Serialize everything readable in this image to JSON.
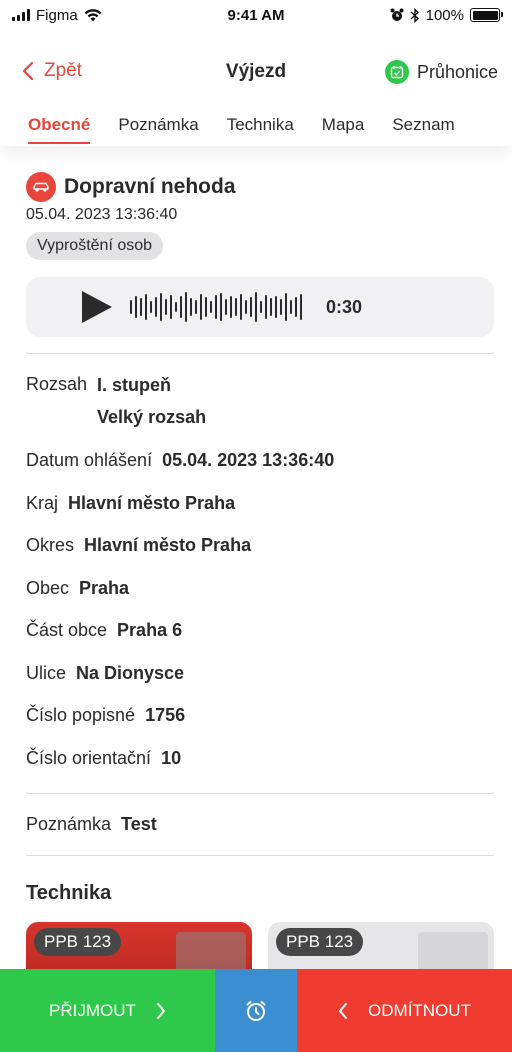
{
  "status_bar": {
    "carrier": "Figma",
    "time": "9:41 AM",
    "battery_percent": "100%",
    "battery_level": 1.0
  },
  "nav": {
    "back_label": "Zpět",
    "title": "Výjezd",
    "station": "Průhonice"
  },
  "tabs": [
    {
      "label": "Obecné",
      "active": true
    },
    {
      "label": "Poznámka",
      "active": false
    },
    {
      "label": "Technika",
      "active": false
    },
    {
      "label": "Mapa",
      "active": false
    },
    {
      "label": "Seznam",
      "active": false
    }
  ],
  "incident": {
    "title": "Dopravní nehoda",
    "datetime": "05.04. 2023 13:36:40",
    "tag": "Vyproštění osob",
    "icon": "car-icon"
  },
  "audio": {
    "duration": "0:30"
  },
  "details": {
    "rozsah": {
      "label": "Rozsah",
      "value1": "I. stupeň",
      "value2": "Velký rozsah"
    },
    "datum": {
      "label": "Datum ohlášení",
      "value": "05.04. 2023 13:36:40"
    },
    "kraj": {
      "label": "Kraj",
      "value": "Hlavní město Praha"
    },
    "okres": {
      "label": "Okres",
      "value": "Hlavní město Praha"
    },
    "obec": {
      "label": "Obec",
      "value": "Praha"
    },
    "cast_obce": {
      "label": "Část obce",
      "value": "Praha 6"
    },
    "ulice": {
      "label": "Ulice",
      "value": "Na Dionysce"
    },
    "cislo_popisne": {
      "label": "Číslo popisné",
      "value": "1756"
    },
    "cislo_orientacni": {
      "label": "Číslo orientační",
      "value": "10"
    }
  },
  "note": {
    "label": "Poznámka",
    "value": "Test"
  },
  "technika": {
    "title": "Technika",
    "cards": [
      {
        "badge": "PPB 123"
      },
      {
        "badge": "PPB 123"
      }
    ]
  },
  "actions": {
    "accept": "PŘIJMOUT",
    "reject": "ODMÍTNOUT"
  },
  "colors": {
    "accent_red": "#e8453c",
    "accept_green": "#2ec84a",
    "alarm_blue": "#3b8fd0",
    "reject_red": "#f03b30"
  }
}
